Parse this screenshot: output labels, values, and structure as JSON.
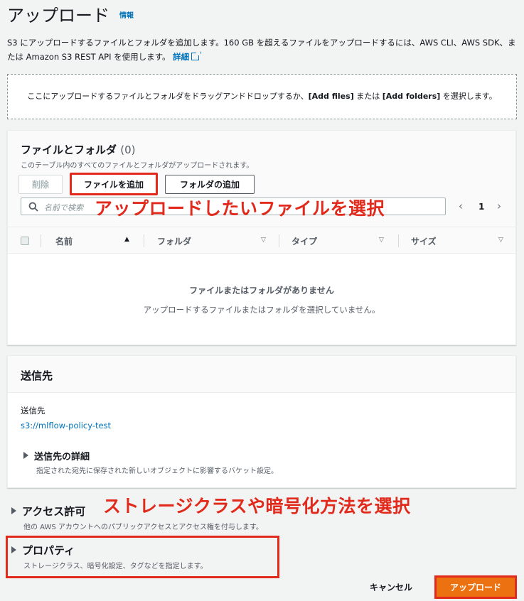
{
  "header": {
    "title": "アップロード",
    "info_link": "情報",
    "description": "S3 にアップロードするファイルとフォルダを追加します。160 GB を超えるファイルをアップロードするには、AWS CLI、AWS SDK、または Amazon S3 REST API を使用します。",
    "details_link": "詳細"
  },
  "dropzone": {
    "text_before": "ここにアップロードするファイルとフォルダをドラッグアンドドロップするか、",
    "add_files": "[Add files]",
    "text_middle": " または ",
    "add_folders": "[Add folders]",
    "text_after": " を選択します。"
  },
  "files": {
    "title": "ファイルとフォルダ",
    "count": "(0)",
    "subtitle": "このテーブル内のすべてのファイルとフォルダがアップロードされます。",
    "delete_label": "削除",
    "add_files_label": "ファイルを追加",
    "add_folder_label": "フォルダの追加",
    "search_placeholder": "名前で検索",
    "page": "1",
    "columns": [
      "名前",
      "フォルダ",
      "タイプ",
      "サイズ"
    ],
    "empty_title": "ファイルまたはフォルダがありません",
    "empty_sub": "アップロードするファイルまたはフォルダを選択していません。"
  },
  "annotations": {
    "select_file": "アップロードしたいファイルを選択",
    "select_class": "ストレージクラスや暗号化方法を選択"
  },
  "destination": {
    "title": "送信先",
    "label": "送信先",
    "value": "s3://mlflow-policy-test",
    "details_title": "送信先の詳細",
    "details_desc": "指定された宛先に保存された新しいオブジェクトに影響するバケット設定。"
  },
  "permissions": {
    "title": "アクセス許可",
    "desc": "他の AWS アカウントへのパブリックアクセスとアクセス権を付与します。"
  },
  "properties": {
    "title": "プロパティ",
    "desc": "ストレージクラス、暗号化設定、タグなどを指定します。"
  },
  "footer": {
    "cancel_label": "キャンセル",
    "upload_label": "アップロード"
  },
  "colors": {
    "accent_orange": "#ec7211",
    "annotation_red": "#e12a1b",
    "link_blue": "#0073bb"
  }
}
